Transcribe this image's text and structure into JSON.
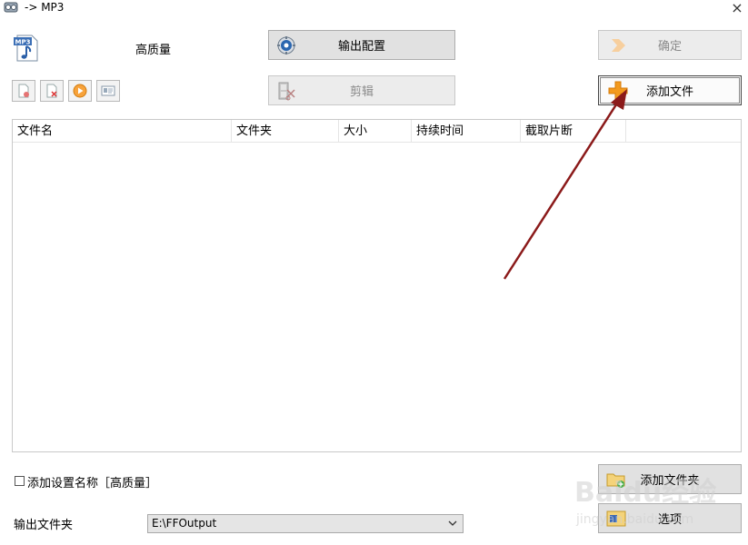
{
  "window": {
    "title": "-> MP3",
    "close_glyph": "×"
  },
  "format": {
    "icon_text": "MP3",
    "quality_name": "高质量"
  },
  "buttons": {
    "output_config": "输出配置",
    "edit": "剪辑",
    "confirm": "确定",
    "add_file": "添加文件",
    "add_folder": "添加文件夹",
    "options": "选项"
  },
  "toolbar": {
    "icons": [
      "remove-file-icon",
      "clear-list-icon",
      "play-icon",
      "info-icon"
    ]
  },
  "file_list": {
    "columns": [
      "文件名",
      "文件夹",
      "大小",
      "持续时间",
      "截取片断",
      ""
    ],
    "rows": []
  },
  "bottom": {
    "add_setting_label": "添加设置名称［高质量］",
    "add_setting_checked": false,
    "output_folder_label": "输出文件夹",
    "output_folder_value": "E:\\FFOutput"
  },
  "watermark": {
    "text": "Baidu经验",
    "subtext": "jingyan.baidu.com"
  },
  "colors": {
    "annotation_arrow": "#8b1a1a",
    "add_icon": "#f39a1e",
    "button_bg": "#e1e1e1"
  }
}
